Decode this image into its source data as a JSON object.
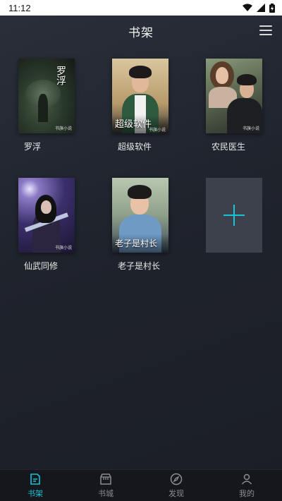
{
  "status_bar": {
    "time": "11:12"
  },
  "header": {
    "title": "书架"
  },
  "books": [
    {
      "label": "罗浮",
      "cover_text": "罗浮",
      "stamp": "书旗小说"
    },
    {
      "label": "超级软件",
      "cover_text": "超级软件",
      "stamp": "书旗小说"
    },
    {
      "label": "农民医生",
      "cover_text": "",
      "stamp": "书旗小说"
    },
    {
      "label": "仙武同修",
      "cover_text": "",
      "stamp": "书旗小说"
    },
    {
      "label": "老子是村长",
      "cover_text": "老子是村长",
      "stamp": ""
    }
  ],
  "add_book": {
    "icon": "plus-icon"
  },
  "tabs": [
    {
      "label": "书架",
      "icon": "bookshelf-icon",
      "active": true
    },
    {
      "label": "书城",
      "icon": "store-icon",
      "active": false
    },
    {
      "label": "发现",
      "icon": "compass-icon",
      "active": false
    },
    {
      "label": "我的",
      "icon": "user-icon",
      "active": false
    }
  ],
  "colors": {
    "accent": "#15c3d6",
    "background": "#1f232c",
    "tabbar": "#15171c"
  }
}
